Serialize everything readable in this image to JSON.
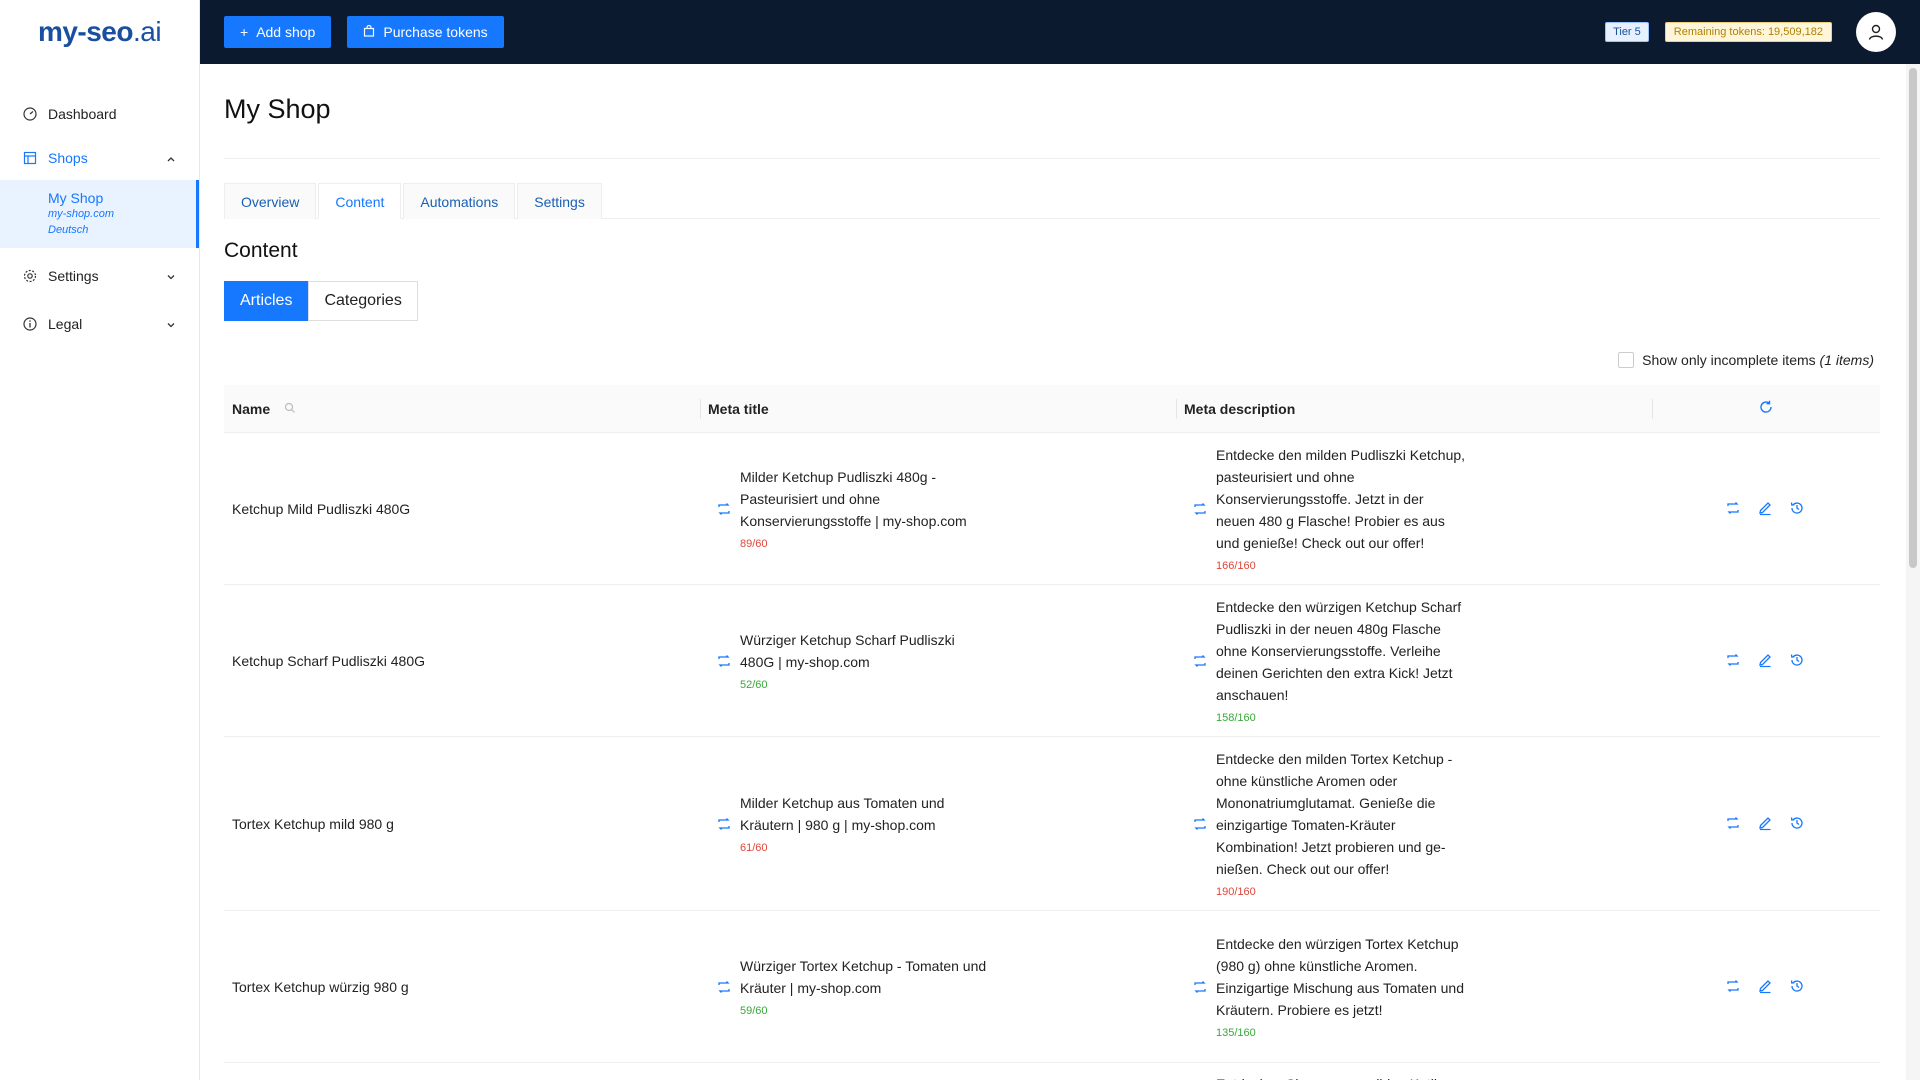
{
  "brand": {
    "logo_main": "my-seo",
    "logo_suffix": ".ai"
  },
  "sidebar": {
    "items": [
      {
        "label": "Dashboard"
      },
      {
        "label": "Shops"
      },
      {
        "label": "Settings"
      },
      {
        "label": "Legal"
      }
    ],
    "active_shop": {
      "name": "My Shop",
      "domain": "my-shop.com",
      "language": "Deutsch"
    }
  },
  "header": {
    "add_shop_label": "Add shop",
    "purchase_tokens_label": "Purchase tokens",
    "tier_label": "Tier 5",
    "tokens_label": "Remaining tokens: 19,509,182"
  },
  "main": {
    "page_title": "My Shop",
    "tabs": [
      {
        "label": "Overview"
      },
      {
        "label": "Content"
      },
      {
        "label": "Automations"
      },
      {
        "label": "Settings"
      }
    ],
    "section_title": "Content",
    "segments": [
      {
        "label": "Articles"
      },
      {
        "label": "Categories"
      }
    ],
    "filter_label": "Show only incomplete items",
    "filter_count": "(1 items)",
    "table": {
      "headers": {
        "name": "Name",
        "meta_title": "Meta title",
        "meta_description": "Meta description"
      },
      "rows": [
        {
          "name": "Ketchup Mild Pudliszki 480G",
          "meta_title": "Milder Ketchup Pudliszki 480g - Pasteurisiert und ohne Konservierungsstoffe | my-shop.com",
          "title_count": "89/60",
          "meta_description": "Entdecke den milden Pudliszki Ketchup, pasteurisiert und ohne Konservierungsstoffe. Jetzt in der neuen 480 g Flasche! Probier es aus und genieße! Check out our offer!",
          "desc_count": "166/160"
        },
        {
          "name": "Ketchup Scharf Pudliszki 480G",
          "meta_title": "Würziger Ketchup Scharf Pudliszki 480G | my-shop.com",
          "title_count": "52/60",
          "meta_description": "Entdecke den würzigen Ketchup Scharf Pudliszki in der neuen 480g Flasche ohne Konservierungsstoffe. Verleihe deinen Gerichten den extra Kick! Jetzt anschauen!",
          "desc_count": "158/160"
        },
        {
          "name": "Tortex Ketchup mild 980 g",
          "meta_title": "Milder Ketchup aus Tomaten und Kräutern | 980 g | my-shop.com",
          "title_count": "61/60",
          "meta_description": "Entdecke den milden Tortex Ketchup - ohne künstliche Aromen oder Mononatriumglutamat. Genieße die einzigartige Tomaten-Kräuter Kombination! Jetzt probieren und ge-nießen. Check out our offer!",
          "desc_count": "190/160"
        },
        {
          "name": "Tortex Ketchup würzig 980 g",
          "meta_title": "Würziger Tortex Ketchup - Tomaten und Kräuter | my-shop.com",
          "title_count": "59/60",
          "meta_description": "Entdecke den würzigen Tortex Ketchup (980 g) ohne künstliche Aromen. Einzigartige Mischung aus Tomaten und Kräutern. Probiere es jetzt!",
          "desc_count": "135/160"
        },
        {
          "name": "",
          "meta_title": "",
          "title_count": "",
          "meta_description": "Entdecken Sie unseren milden Kotlin",
          "desc_count": ""
        }
      ]
    }
  },
  "colors": {
    "primary": "#1677ff",
    "header_bg": "#0b1a2f",
    "over_limit": "#e0463b",
    "within_limit": "#3aa83a"
  }
}
